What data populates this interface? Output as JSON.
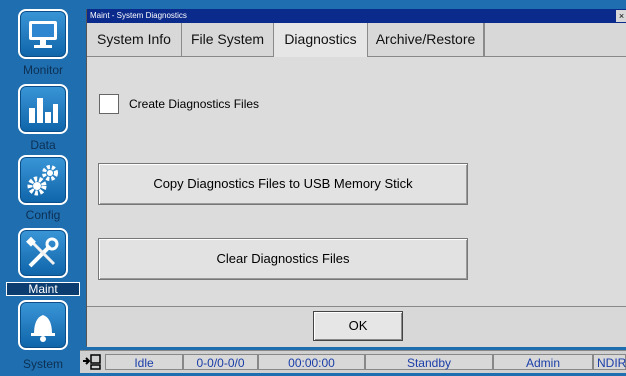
{
  "nav": {
    "items": [
      {
        "label": "Monitor",
        "icon": "monitor-icon"
      },
      {
        "label": "Data",
        "icon": "bar-chart-icon"
      },
      {
        "label": "Config",
        "icon": "gears-icon"
      },
      {
        "label": "Maint",
        "icon": "tools-icon"
      },
      {
        "label": "System",
        "icon": "bell-icon"
      }
    ]
  },
  "window": {
    "title": "Maint - System Diagnostics",
    "close": "×"
  },
  "tabs": [
    {
      "label": "System Info"
    },
    {
      "label": "File System"
    },
    {
      "label": "Diagnostics"
    },
    {
      "label": "Archive/Restore"
    }
  ],
  "content": {
    "create_label": "Create Diagnostics Files",
    "create_checked": false,
    "copy_button": "Copy Diagnostics Files to USB Memory Stick",
    "clear_button": "Clear Diagnostics Files"
  },
  "footer": {
    "ok": "OK"
  },
  "status": {
    "cells": [
      "Idle",
      "0-0/0-0/0",
      "00:00:00",
      "Standby",
      "Admin",
      "NDIR"
    ]
  },
  "colors": {
    "nav_bg": "#1f6fb0",
    "title_bg": "#0a2a8c",
    "status_text": "#1a3ea8"
  }
}
